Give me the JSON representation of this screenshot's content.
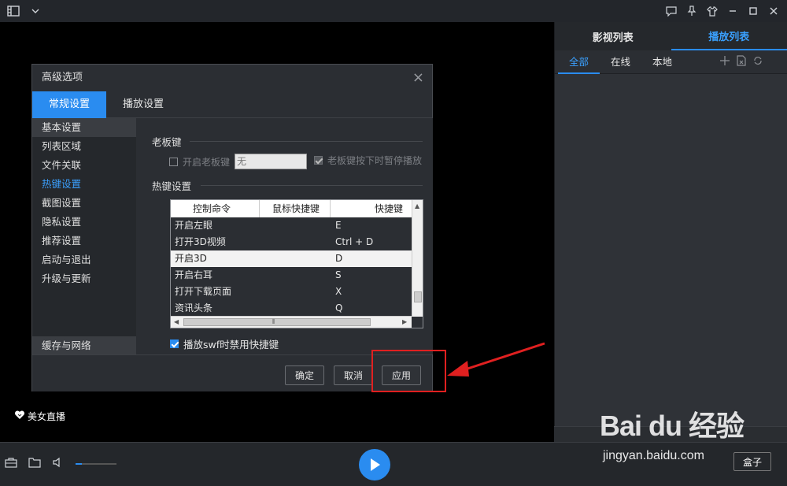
{
  "app": {
    "titlebar": {
      "icons": [
        "menu-film-icon",
        "chevron-down-icon",
        "feedback-icon",
        "pin-icon",
        "skin-icon",
        "minimize-icon",
        "maximize-icon",
        "close-icon"
      ]
    },
    "right_panel": {
      "tabs": [
        {
          "label": "影视列表",
          "active": false
        },
        {
          "label": "播放列表",
          "active": true
        }
      ],
      "subtabs": [
        {
          "label": "全部",
          "active": true
        },
        {
          "label": "在线",
          "active": false
        },
        {
          "label": "本地",
          "active": false
        }
      ]
    },
    "live_label": "美女直播",
    "control_bar": {
      "volume_level": 0.15,
      "box_label": "盒子"
    }
  },
  "dialog": {
    "title": "高级选项",
    "tabs": [
      {
        "label": "常规设置",
        "active": true
      },
      {
        "label": "播放设置",
        "active": false
      }
    ],
    "sidebar": [
      {
        "label": "基本设置",
        "state": "hover"
      },
      {
        "label": "列表区域",
        "state": ""
      },
      {
        "label": "文件关联",
        "state": ""
      },
      {
        "label": "热键设置",
        "state": "active"
      },
      {
        "label": "截图设置",
        "state": ""
      },
      {
        "label": "隐私设置",
        "state": ""
      },
      {
        "label": "推荐设置",
        "state": ""
      },
      {
        "label": "启动与退出",
        "state": ""
      },
      {
        "label": "升级与更新",
        "state": ""
      }
    ],
    "sidebar_bottom": "缓存与网络",
    "boss_key": {
      "section_title": "老板键",
      "enable_label": "开启老板键",
      "enable_checked": false,
      "input_value": "无",
      "pause_label": "老板键按下时暂停播放",
      "pause_checked": true
    },
    "hotkeys": {
      "section_title": "热键设置",
      "headers": [
        "控制命令",
        "鼠标快捷键",
        "快捷键"
      ],
      "rows": [
        {
          "command": "开启左眼",
          "mouse": "",
          "key": "E"
        },
        {
          "command": "打开3D视频",
          "mouse": "",
          "key": "Ctrl + D"
        },
        {
          "command": "开启3D",
          "mouse": "",
          "key": "D"
        },
        {
          "command": "开启右耳",
          "mouse": "",
          "key": "S"
        },
        {
          "command": "打开下载页面",
          "mouse": "",
          "key": "X"
        },
        {
          "command": "资讯头条",
          "mouse": "",
          "key": "Q"
        }
      ],
      "selected_row": 2,
      "scroll_arrows": {
        "up": "▲",
        "down": "▼",
        "left": "◀",
        "right": "▶",
        "grip": "⦀"
      }
    },
    "swf_label": "播放swf时禁用快捷键",
    "swf_checked": true,
    "buttons": {
      "ok": "确定",
      "cancel": "取消",
      "apply": "应用"
    }
  },
  "annotation": {
    "highlight_color": "#e02020"
  },
  "watermark": {
    "brand": "Bai du 经验",
    "url": "jingyan.baidu.com"
  },
  "colors": {
    "accent": "#2a8cf0",
    "panel": "#2b2e33",
    "annotation": "#e02020"
  }
}
